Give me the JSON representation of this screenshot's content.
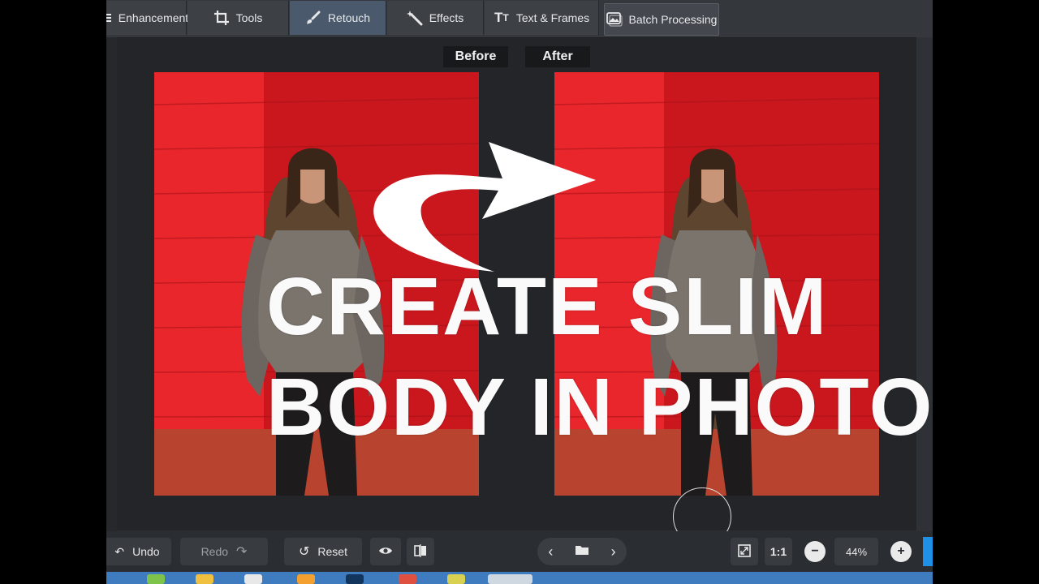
{
  "tabs": [
    {
      "label": "Enhancement",
      "icon": "menu-icon"
    },
    {
      "label": "Tools",
      "icon": "crop-icon"
    },
    {
      "label": "Retouch",
      "icon": "brush-icon",
      "active": true
    },
    {
      "label": "Effects",
      "icon": "magic-wand-icon"
    },
    {
      "label": "Text & Frames",
      "icon": "text-icon"
    },
    {
      "label": "Batch Processing",
      "icon": "images-icon"
    }
  ],
  "compare": {
    "before": "Before",
    "after": "After"
  },
  "overlay": {
    "line1": "CREATE SLIM",
    "line2": "BODY IN PHOTO"
  },
  "toolbar": {
    "undo": "Undo",
    "redo": "Redo",
    "reset": "Reset",
    "zoom_fit": "1:1",
    "zoom_level": "44%"
  },
  "colors": {
    "accent": "#1e90e6",
    "photo_bg": "#e01f26",
    "overlay_text": "#fafafa"
  }
}
